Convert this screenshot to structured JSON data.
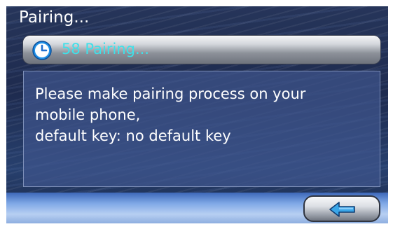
{
  "title_bar": {
    "title": "Pairing..."
  },
  "status": {
    "countdown": "58",
    "label": "Pairing...",
    "icon": "clock-icon",
    "text_color": "#3fe0e9"
  },
  "message": {
    "lines": [
      "Please make pairing process on your",
      "mobile phone,",
      "default key: no default key"
    ]
  },
  "footer": {
    "back_button_icon": "back-arrow-icon",
    "arrow_color": "#3aa6e8"
  }
}
